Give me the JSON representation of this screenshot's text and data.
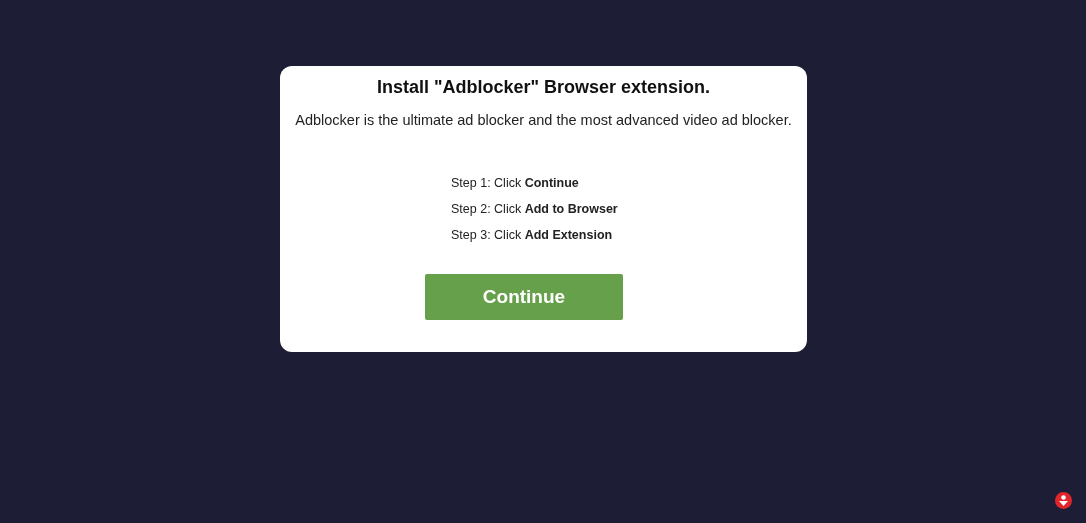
{
  "dialog": {
    "title": "Install \"Adblocker\" Browser extension.",
    "description": "Adblocker is the ultimate ad blocker and the most advanced video ad blocker.",
    "steps": [
      "Step 1: Click **Continue**",
      "Step 2: Click **Add to Browser**",
      "Step 3: Click **Add Extension**"
    ],
    "button": "Continue"
  }
}
